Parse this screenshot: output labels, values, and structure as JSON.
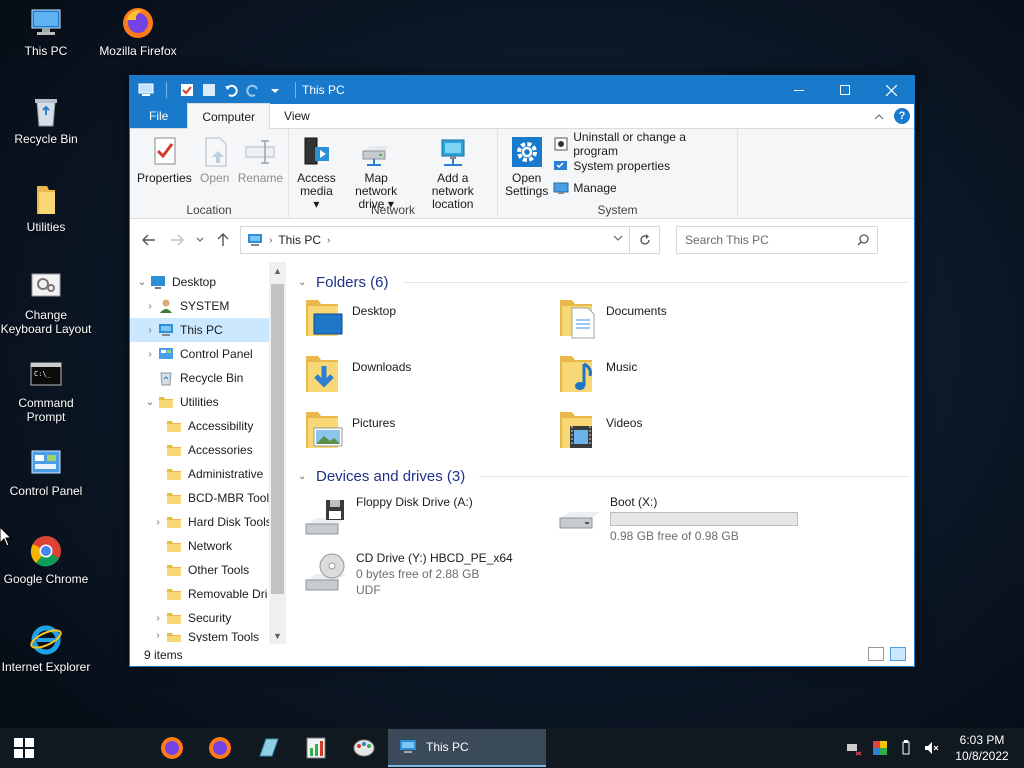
{
  "desktop": {
    "icons": [
      {
        "label": "This PC"
      },
      {
        "label": "Mozilla Firefox"
      },
      {
        "label": "Recycle Bin"
      },
      {
        "label": "Utilities"
      },
      {
        "label": "Change Keyboard Layout"
      },
      {
        "label": "Command Prompt"
      },
      {
        "label": "Control Panel"
      },
      {
        "label": "Google Chrome"
      },
      {
        "label": "Internet Explorer"
      }
    ]
  },
  "window": {
    "title": "This PC",
    "tabs": {
      "file": "File",
      "computer": "Computer",
      "view": "View"
    },
    "ribbon": {
      "location": {
        "label": "Location",
        "properties": "Properties",
        "open": "Open",
        "rename": "Rename"
      },
      "network": {
        "label": "Network",
        "access_media_1": "Access",
        "access_media_2": "media",
        "map_drive_1": "Map network",
        "map_drive_2": "drive",
        "add_location_1": "Add a network",
        "add_location_2": "location"
      },
      "system": {
        "label": "System",
        "open_settings_1": "Open",
        "open_settings_2": "Settings",
        "uninstall": "Uninstall or change a program",
        "system_properties": "System properties",
        "manage": "Manage"
      }
    },
    "address": {
      "crumb": "This PC"
    },
    "search": {
      "placeholder": "Search This PC"
    },
    "nav_tree": [
      {
        "label": "Desktop"
      },
      {
        "label": "SYSTEM"
      },
      {
        "label": "This PC"
      },
      {
        "label": "Control Panel"
      },
      {
        "label": "Recycle Bin"
      },
      {
        "label": "Utilities"
      },
      {
        "label": "Accessibility"
      },
      {
        "label": "Accessories"
      },
      {
        "label": "Administrative"
      },
      {
        "label": "BCD-MBR Tool"
      },
      {
        "label": "Hard Disk Tools"
      },
      {
        "label": "Network"
      },
      {
        "label": "Other Tools"
      },
      {
        "label": "Removable Dri"
      },
      {
        "label": "Security"
      },
      {
        "label": "System Tools"
      }
    ],
    "folders_header": "Folders (6)",
    "folders": [
      {
        "name": "Desktop"
      },
      {
        "name": "Documents"
      },
      {
        "name": "Downloads"
      },
      {
        "name": "Music"
      },
      {
        "name": "Pictures"
      },
      {
        "name": "Videos"
      }
    ],
    "devices_header": "Devices and drives (3)",
    "drives": [
      {
        "name": "Floppy Disk Drive (A:)"
      },
      {
        "name": "Boot (X:)",
        "free_text": "0.98 GB free of 0.98 GB",
        "used_fraction": 0.0
      },
      {
        "name": "CD Drive (Y:) HBCD_PE_x64",
        "free_text": "0 bytes free of 2.88 GB",
        "fs": "UDF"
      }
    ],
    "status": {
      "items": "9 items"
    }
  },
  "taskbar": {
    "active_window": "This PC",
    "time": "6:03 PM",
    "date": "10/8/2022"
  },
  "colors": {
    "accent": "#1979ca",
    "selection": "#cce8ff",
    "folder": "#f8d775",
    "section_header": "#1e3287"
  }
}
